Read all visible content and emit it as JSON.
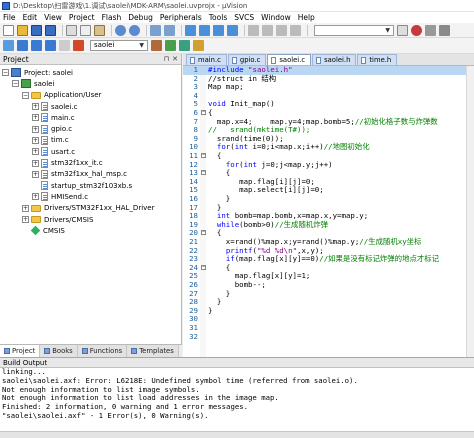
{
  "window": {
    "title": "D:\\Desktop\\扫雷游戏\\1.调试\\saolei\\MDK-ARM\\saolei.uvprojx - µVision"
  },
  "menu": [
    "File",
    "Edit",
    "View",
    "Project",
    "Flash",
    "Debug",
    "Peripherals",
    "Tools",
    "SVCS",
    "Window",
    "Help"
  ],
  "toolbar2": {
    "target": "saolei"
  },
  "project_panel": {
    "title": "Project",
    "root": "Project: saolei",
    "target": "saolei",
    "group": "Application/User",
    "files": [
      "saolei.c",
      "main.c",
      "gpio.c",
      "tim.c",
      "usart.c",
      "stm32f1xx_it.c",
      "stm32f1xx_hal_msp.c",
      "startup_stm32f103xb.s",
      "HMISend.c"
    ],
    "drivers": [
      "Drivers/STM32F1xx_HAL_Driver",
      "Drivers/CMSIS"
    ],
    "cmsis": "CMSIS"
  },
  "panel_tabs": [
    "Project",
    "Books",
    "Functions",
    "Templates"
  ],
  "editor": {
    "tabs": [
      "main.c",
      "gpio.c",
      "saolei.c",
      "saolei.h",
      "time.h"
    ],
    "active_tab": 2,
    "first_line": 1,
    "lines": [
      [
        [
          "pp",
          "#include "
        ],
        [
          "st",
          "\"saolei.h\""
        ]
      ],
      [
        [
          "",
          "//struct in 结构"
        ]
      ],
      [
        [
          "",
          "Map map;"
        ]
      ],
      [
        [
          "",
          ""
        ]
      ],
      [
        [
          "kw",
          "void"
        ],
        [
          "",
          " Init_map()"
        ]
      ],
      [
        [
          "",
          "{"
        ]
      ],
      [
        [
          "",
          "  map.x=4;    map.y=4;map.bomb=5;"
        ],
        [
          "cm",
          "//初始化格子数与炸弹数"
        ]
      ],
      [
        [
          "cm",
          "//   srand(mktime(T#));"
        ]
      ],
      [
        [
          "",
          "  srand(time(0));"
        ]
      ],
      [
        [
          "",
          "  "
        ],
        [
          "kw",
          "for"
        ],
        [
          "",
          "("
        ],
        [
          "kw",
          "int"
        ],
        [
          "",
          " i=0;i<map.x;i++)"
        ],
        [
          "cm",
          "//地图初始化"
        ]
      ],
      [
        [
          "",
          "  {"
        ]
      ],
      [
        [
          "",
          "    "
        ],
        [
          "kw",
          "for"
        ],
        [
          "",
          "("
        ],
        [
          "kw",
          "int"
        ],
        [
          "",
          " j=0;j<map.y;j++)"
        ]
      ],
      [
        [
          "",
          "    {"
        ]
      ],
      [
        [
          "",
          "       map.flag[i][j]=0;"
        ]
      ],
      [
        [
          "",
          "       map.select[i][j]=0;"
        ]
      ],
      [
        [
          "",
          "    }"
        ]
      ],
      [
        [
          "",
          "  }"
        ]
      ],
      [
        [
          "",
          "  "
        ],
        [
          "kw",
          "int"
        ],
        [
          "",
          " bomb=map.bomb,x=map.x,y=map.y;"
        ]
      ],
      [
        [
          "",
          "  "
        ],
        [
          "kw",
          "while"
        ],
        [
          "",
          "(bomb>0)"
        ],
        [
          "cm",
          "//生成随机炸弹"
        ]
      ],
      [
        [
          "",
          "  {"
        ]
      ],
      [
        [
          "",
          "    x=rand()%map.x;y=rand()%map.y;"
        ],
        [
          "cm",
          "//生成随机xy坐标"
        ]
      ],
      [
        [
          "",
          "    "
        ],
        [
          "kw",
          "printf"
        ],
        [
          "",
          "("
        ],
        [
          "st",
          "\"%d %d\\n\""
        ],
        [
          "",
          ",x,y);"
        ]
      ],
      [
        [
          "",
          "    "
        ],
        [
          "kw",
          "if"
        ],
        [
          "",
          "(map.flag[x][y]==0)"
        ],
        [
          "cm",
          "//如果是没有标记炸弹的地点才标记"
        ]
      ],
      [
        [
          "",
          "    {"
        ]
      ],
      [
        [
          "",
          "      map.flag[x][y]=1;"
        ]
      ],
      [
        [
          "",
          "      bomb--;"
        ]
      ],
      [
        [
          "",
          "    }"
        ]
      ],
      [
        [
          "",
          "  }"
        ]
      ],
      [
        [
          "",
          "}"
        ]
      ],
      [
        [
          "",
          ""
        ]
      ],
      [
        [
          "",
          ""
        ]
      ],
      [
        [
          "",
          ""
        ]
      ]
    ],
    "fold_lines": [
      6,
      11,
      13,
      20,
      24
    ]
  },
  "build_output": {
    "title": "Build Output",
    "lines": [
      "linking...",
      "saolei\\saolei.axf: Error: L6218E: Undefined symbol time (referred from saolei.o).",
      "Not enough information to list image symbols.",
      "Not enough information to list load addresses in the image map.",
      "Finished: 2 information, 0 warning and 1 error messages.",
      "\"saolei\\saolei.axf\" - 1 Error(s), 0 Warning(s)."
    ]
  },
  "colors": {
    "keyword": "#0000ff",
    "comment": "#008000",
    "string": "#8a008a",
    "selection": "#b9d7f3"
  }
}
